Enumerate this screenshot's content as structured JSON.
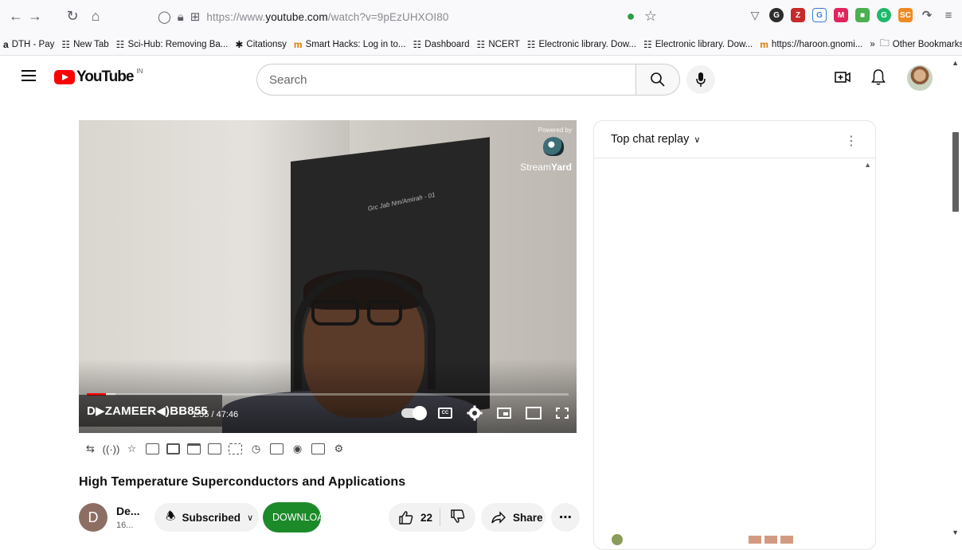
{
  "browser": {
    "url_prefix": "https://www.",
    "url_domain": "youtube.com",
    "url_path": "/watch?v=9pEzUHXOI80",
    "bookmarks": [
      {
        "label": "DTH - Pay",
        "icon": "amazon-icon"
      },
      {
        "label": "New Tab",
        "icon": "globe-icon"
      },
      {
        "label": "Sci-Hub: Removing Ba...",
        "icon": "globe-icon"
      },
      {
        "label": "Citationsy",
        "icon": "asterisk-icon"
      },
      {
        "label": "Smart Hacks: Log in to...",
        "icon": "m-icon"
      },
      {
        "label": "Dashboard",
        "icon": "globe-icon"
      },
      {
        "label": "NCERT",
        "icon": "globe-icon"
      },
      {
        "label": "Electronic library. Dow...",
        "icon": "globe-icon"
      },
      {
        "label": "Electronic library. Dow...",
        "icon": "globe-icon"
      },
      {
        "label": "https://haroon.gnomi...",
        "icon": "m-icon"
      }
    ],
    "other_bookmarks": "Other Bookmarks"
  },
  "youtube": {
    "logo_text": "YouTube",
    "country_code": "IN",
    "search_placeholder": "Search"
  },
  "player": {
    "powered_by": "Powered by",
    "brand_stream": "Stream",
    "brand_yard": "Yard",
    "cabinet_label": "Grc Jab Nm/Amirah - 01",
    "overlay_text": "D▶ZAMEER◀)BB855",
    "time_current": "1:55",
    "time_separator": "/",
    "time_total": "47:46",
    "progress_played": 0.04,
    "progress_loaded": 0.06
  },
  "video": {
    "title": "High Temperature Superconductors and Applications",
    "channel_initial": "D",
    "channel_name": "De...",
    "channel_subs": "16...",
    "subscribe_label": "Subscribed",
    "download_label": "DOWNLOA",
    "likes": "22",
    "share_label": "Share"
  },
  "chat": {
    "header": "Top chat replay"
  },
  "colors": {
    "accent_red": "#ff0000",
    "download_green": "#1d8a2a"
  }
}
